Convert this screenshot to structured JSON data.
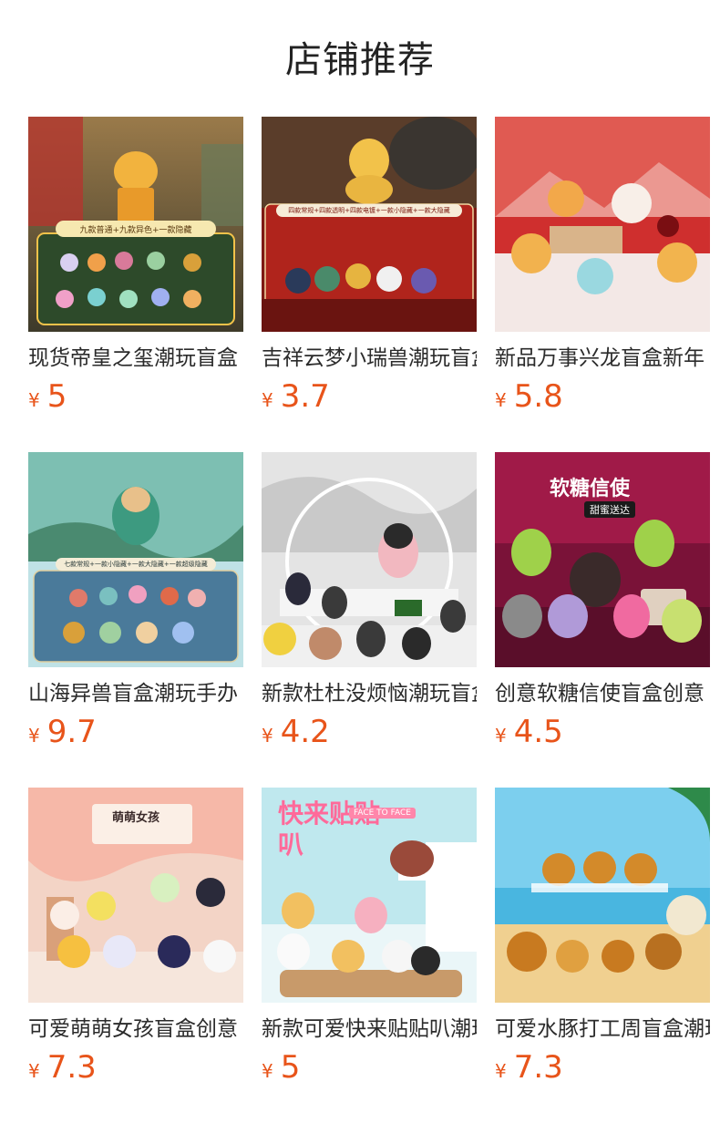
{
  "header": {
    "title": "店铺推荐"
  },
  "products": [
    {
      "title": "现货帝皇之玺潮玩盲盒",
      "currency": "¥",
      "price": "5",
      "image": "golden-dragon-seal-figure",
      "banner": "九款普通+九款异色+一款隐藏",
      "colors": [
        "#6b5a3a",
        "#e8a13a"
      ]
    },
    {
      "title": "吉祥云梦小瑞兽潮玩盲盒",
      "currency": "¥",
      "price": "3.7",
      "image": "auspicious-beast-figures",
      "banner": "四款常规+四款透明+四款电镀+一款小隐藏+一款大隐藏",
      "colors": [
        "#8c1c14",
        "#e64a2e"
      ]
    },
    {
      "title": "新品万事兴龙盲盒新年",
      "currency": "¥",
      "price": "5.8",
      "image": "cute-dragon-figures",
      "colors": [
        "#c8282a",
        "#f2d9d4"
      ]
    },
    {
      "title": "山海异兽盲盒潮玩手办",
      "currency": "¥",
      "price": "9.7",
      "image": "green-dragon-figure",
      "banner": "七款常规+一款小隐藏+一款大隐藏+一款超级隐藏",
      "colors": [
        "#2f8a7c",
        "#bfe6ea"
      ]
    },
    {
      "title": "新款杜杜没烦恼潮玩盲盒",
      "currency": "¥",
      "price": "4.2",
      "image": "penguin-bird-figures",
      "colors": [
        "#d8d8d8",
        "#3a3a3a"
      ]
    },
    {
      "title": "创意软糖信使盲盒创意",
      "currency": "¥",
      "price": "4.5",
      "image": "gummy-messenger-figures",
      "banner": "软糖信使",
      "subbanner": "甜蜜送达",
      "colors": [
        "#7a1238",
        "#9fd14a"
      ]
    },
    {
      "title": "可爱萌萌女孩盲盒创意",
      "currency": "¥",
      "price": "7.3",
      "image": "cute-girl-figures",
      "banner": "萌萌女孩",
      "colors": [
        "#f1c9b8",
        "#8a5a42"
      ]
    },
    {
      "title": "新款可爱快来贴贴叭潮玩",
      "currency": "¥",
      "price": "5",
      "image": "face-to-face-figures",
      "banner": "快来贴贴叭",
      "subbanner": "FACE TO FACE",
      "colors": [
        "#b9e6ec",
        "#f2b8c6"
      ]
    },
    {
      "title": "可爱水豚打工周盲盒潮玩",
      "currency": "¥",
      "price": "7.3",
      "image": "capybara-figures",
      "colors": [
        "#6fc6e8",
        "#d78a2a"
      ]
    }
  ]
}
